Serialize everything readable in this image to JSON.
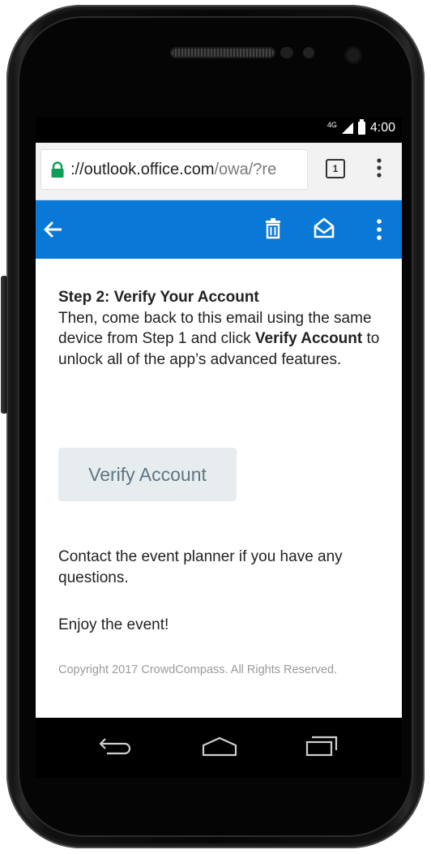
{
  "status_bar": {
    "network": "4G",
    "time": "4:00"
  },
  "browser": {
    "url_host": "://outlook.office.com",
    "url_path": "/owa/?re",
    "tab_count": "1"
  },
  "email": {
    "step_title": "Step 2: Verify Your Account",
    "body_intro": "Then, come back to this email using the same device from Step 1 and click ",
    "body_bold": "Verify Account",
    "body_outro": " to unlock all of the app’s advanced features.",
    "verify_button": "Verify Account",
    "contact_text": "Contact the event planner if you have any questions.",
    "closing": "Enjoy the event!",
    "copyright": "Copyright 2017 CrowdCompass. All Rights Reserved."
  },
  "colors": {
    "app_bar": "#0a78d7",
    "button_bg": "#e7ecef",
    "button_text": "#5e7584",
    "lock_green": "#0f9d58"
  }
}
